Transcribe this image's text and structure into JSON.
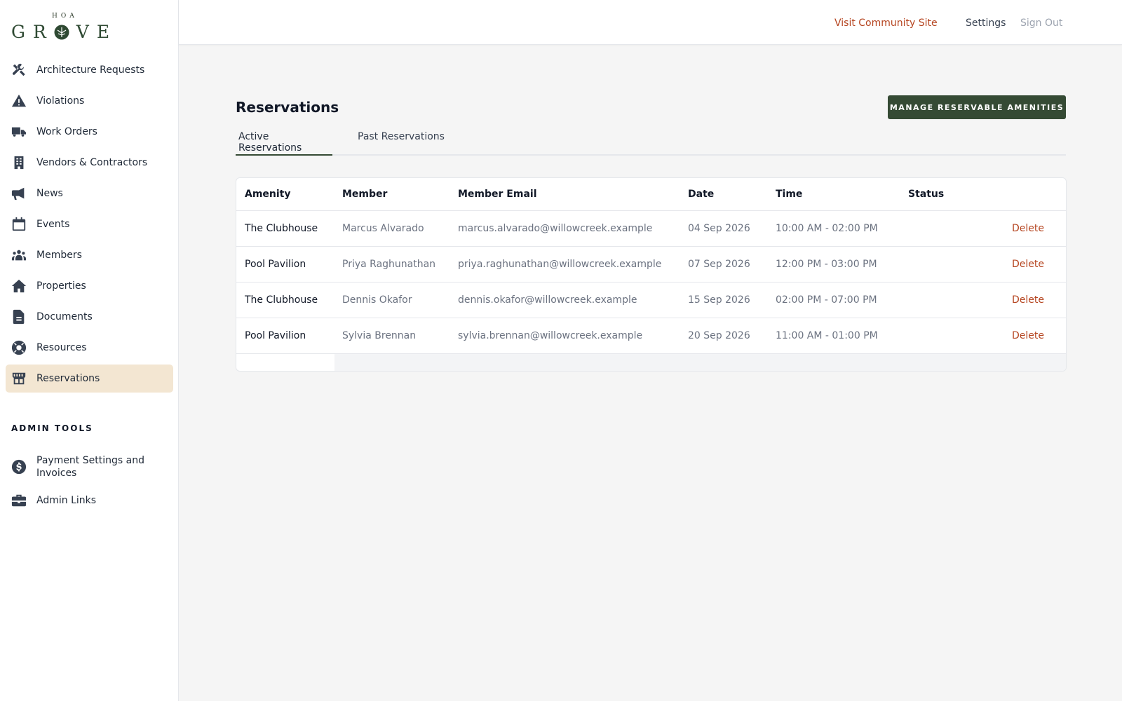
{
  "brand": {
    "small": "HOA",
    "word_left": "GR",
    "word_right": "VE"
  },
  "sidebar": {
    "items": [
      {
        "label": "Architecture Requests",
        "icon": "tools-icon"
      },
      {
        "label": "Violations",
        "icon": "warning-icon"
      },
      {
        "label": "Work Orders",
        "icon": "truck-icon"
      },
      {
        "label": "Vendors & Contractors",
        "icon": "building-icon"
      },
      {
        "label": "News",
        "icon": "megaphone-icon"
      },
      {
        "label": "Events",
        "icon": "calendar-icon"
      },
      {
        "label": "Members",
        "icon": "users-icon"
      },
      {
        "label": "Properties",
        "icon": "home-icon"
      },
      {
        "label": "Documents",
        "icon": "document-icon"
      },
      {
        "label": "Resources",
        "icon": "lifebuoy-icon"
      },
      {
        "label": "Reservations",
        "icon": "store-icon",
        "active": true
      }
    ],
    "admin_heading": "ADMIN TOOLS",
    "admin_items": [
      {
        "label": "Payment Settings and Invoices",
        "icon": "dollar-icon"
      },
      {
        "label": "Admin Links",
        "icon": "briefcase-icon"
      }
    ]
  },
  "header": {
    "visit_link": "Visit Community Site",
    "settings": "Settings",
    "sign_out": "Sign Out"
  },
  "main": {
    "title": "Reservations",
    "manage_button": "MANAGE RESERVABLE AMENITIES",
    "tabs": [
      {
        "label": "Active Reservations",
        "active": true
      },
      {
        "label": "Past Reservations",
        "active": false
      }
    ],
    "table": {
      "columns": [
        "Amenity",
        "Member",
        "Member Email",
        "Date",
        "Time",
        "Status"
      ],
      "rows": [
        {
          "amenity": "The Clubhouse",
          "member": "Marcus Alvarado",
          "email": "marcus.alvarado@willowcreek.example",
          "date": "04 Sep 2026",
          "time": "10:00 AM - 02:00 PM",
          "status": "",
          "action": "Delete"
        },
        {
          "amenity": "Pool Pavilion",
          "member": "Priya Raghunathan",
          "email": "priya.raghunathan@willowcreek.example",
          "date": "07 Sep 2026",
          "time": "12:00 PM - 03:00 PM",
          "status": "",
          "action": "Delete"
        },
        {
          "amenity": "The Clubhouse",
          "member": "Dennis Okafor",
          "email": "dennis.okafor@willowcreek.example",
          "date": "15 Sep 2026",
          "time": "02:00 PM - 07:00 PM",
          "status": "",
          "action": "Delete"
        },
        {
          "amenity": "Pool Pavilion",
          "member": "Sylvia Brennan",
          "email": "sylvia.brennan@willowcreek.example",
          "date": "20 Sep 2026",
          "time": "11:00 AM - 01:00 PM",
          "status": "",
          "action": "Delete"
        }
      ]
    }
  },
  "colors": {
    "brand_green": "#354a34",
    "accent_orange": "#b5441f",
    "active_nav_bg": "#f3e6d2"
  }
}
